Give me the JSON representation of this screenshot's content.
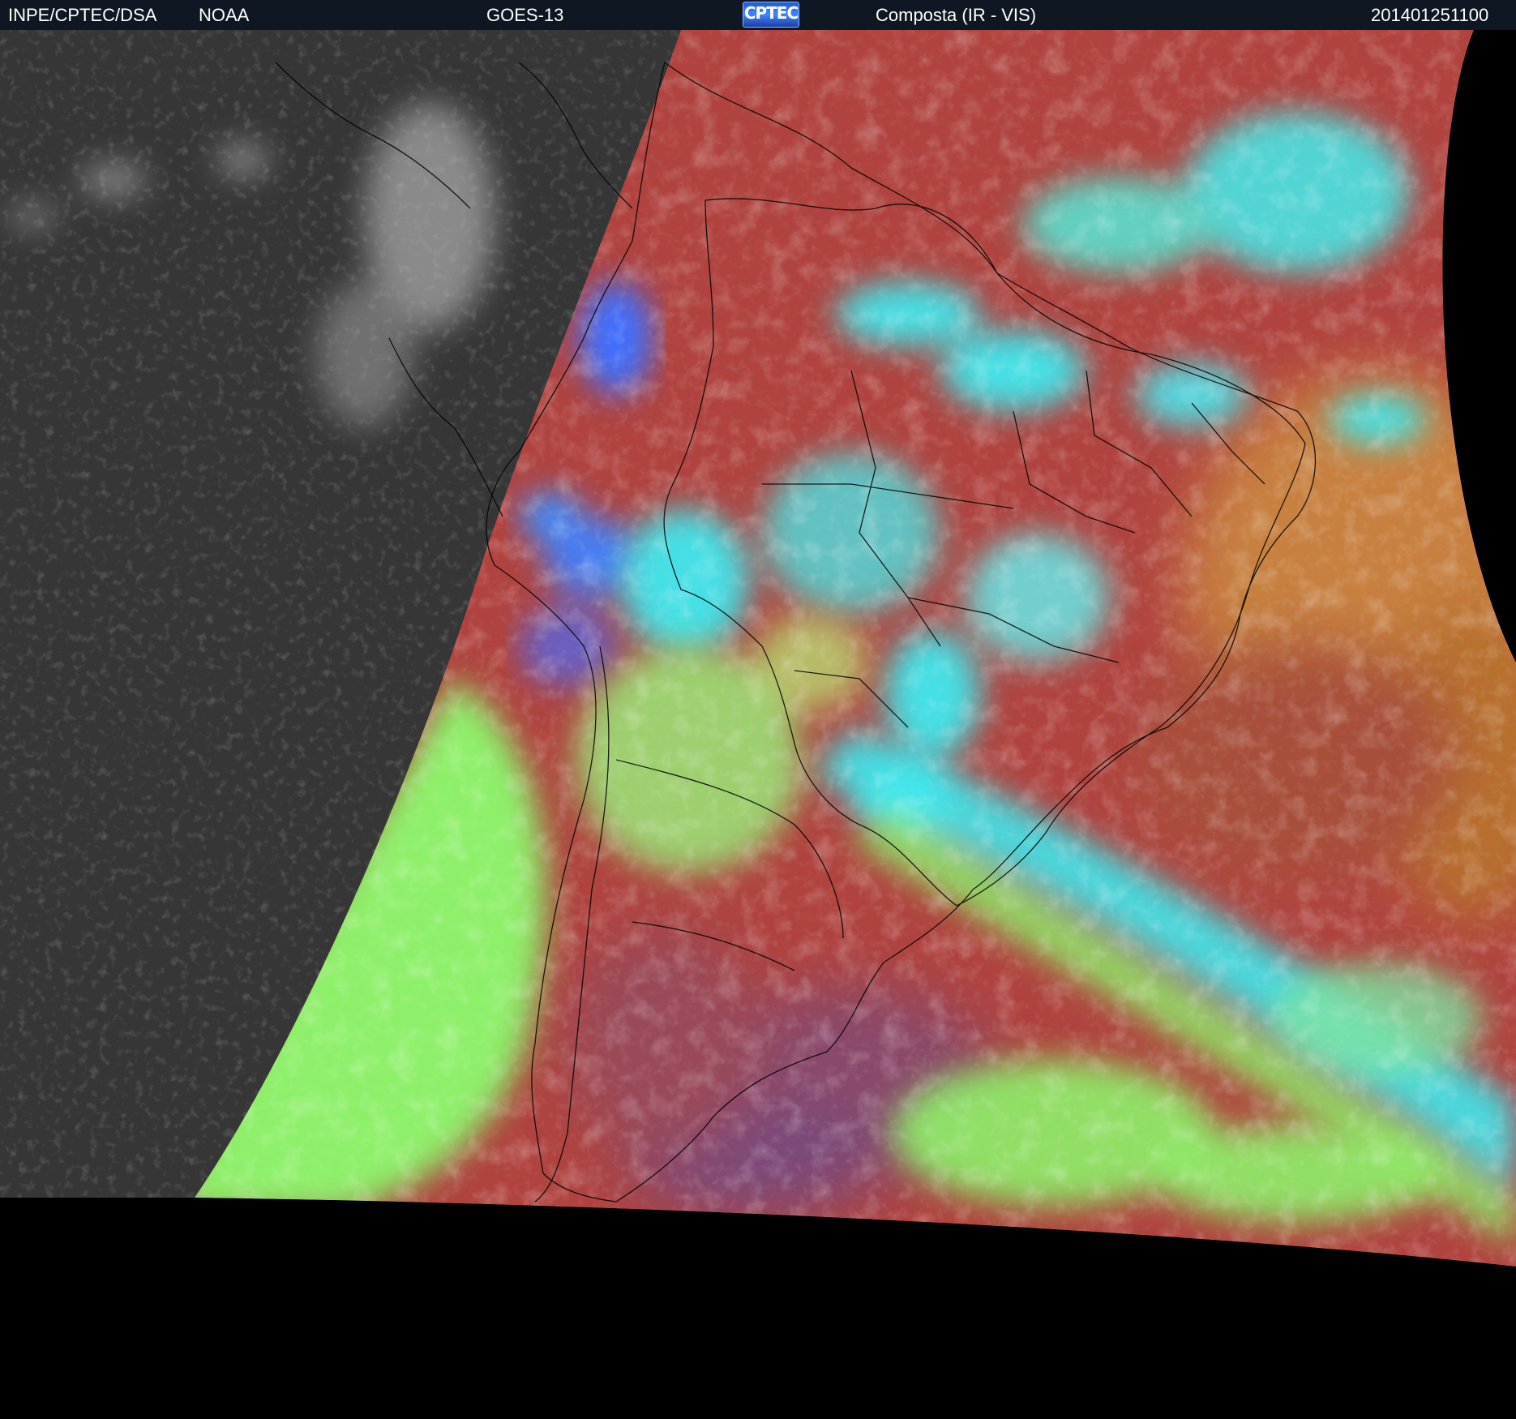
{
  "header": {
    "agency": "INPE/CPTEC/DSA",
    "source": "NOAA",
    "satellite": "GOES-13",
    "logo_text": "CPTEC",
    "product": "Composta (IR - VIS)",
    "timestamp": "201401251100"
  },
  "image": {
    "ir_side_color": "#3a3a3a",
    "land_red": "#b0433f",
    "cloud_cyan": "#3fe8ee",
    "cloud_green": "#8ef06a",
    "ocean_orange": "#c88040",
    "cloud_blue": "#3f6fff",
    "border_color": "#000000"
  }
}
